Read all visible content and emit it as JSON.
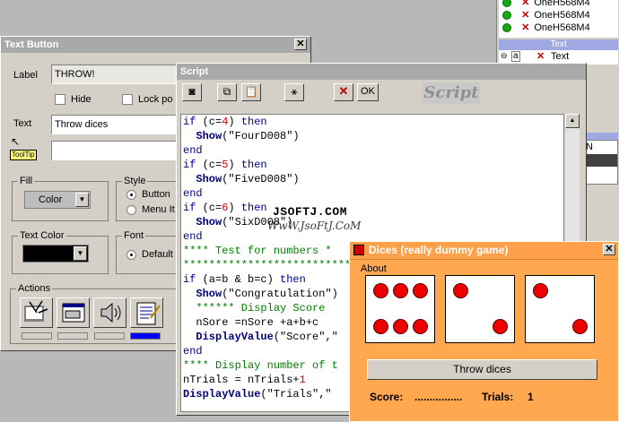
{
  "tree": {
    "items": [
      "OneH568M4",
      "OneH568M4",
      "OneH568M4"
    ],
    "section_title": "Text",
    "section_item": "Text",
    "side_letter": "N"
  },
  "text_button": {
    "title": "Text Button",
    "close": "✕",
    "label_caption": "Label",
    "label_value": "THROW!",
    "hide": "Hide",
    "lock": "Lock po",
    "text_caption": "Text",
    "text_value": "Throw dices",
    "tooltip_tag": "ToolTip",
    "fill_group": "Fill",
    "fill_value": "Color",
    "style_group": "Style",
    "style_button": "Button",
    "style_menu": "Menu It",
    "text_color_group": "Text Color",
    "font_group": "Font",
    "font_default": "Default",
    "actions_group": "Actions"
  },
  "script": {
    "title": "Script",
    "ok": "OK",
    "logo": "Script",
    "lines": [
      [
        {
          "t": "if",
          "c": "kw"
        },
        {
          "t": " (c=",
          "c": ""
        },
        {
          "t": "4",
          "c": "num"
        },
        {
          "t": ") ",
          "c": ""
        },
        {
          "t": "then",
          "c": "kw"
        }
      ],
      [
        {
          "t": "  ",
          "c": ""
        },
        {
          "t": "Show",
          "c": "fn"
        },
        {
          "t": "(\"FourD008\")",
          "c": ""
        }
      ],
      [
        {
          "t": "end",
          "c": "kw"
        }
      ],
      [
        {
          "t": "if",
          "c": "kw"
        },
        {
          "t": " (c=",
          "c": ""
        },
        {
          "t": "5",
          "c": "num"
        },
        {
          "t": ") ",
          "c": ""
        },
        {
          "t": "then",
          "c": "kw"
        }
      ],
      [
        {
          "t": "  ",
          "c": ""
        },
        {
          "t": "Show",
          "c": "fn"
        },
        {
          "t": "(\"FiveD008\")",
          "c": ""
        }
      ],
      [
        {
          "t": "end",
          "c": "kw"
        }
      ],
      [
        {
          "t": "if",
          "c": "kw"
        },
        {
          "t": " (c=",
          "c": ""
        },
        {
          "t": "6",
          "c": "num"
        },
        {
          "t": ") ",
          "c": ""
        },
        {
          "t": "then",
          "c": "kw"
        }
      ],
      [
        {
          "t": "  ",
          "c": ""
        },
        {
          "t": "Show",
          "c": "fn"
        },
        {
          "t": "(\"SixD008\")",
          "c": ""
        }
      ],
      [
        {
          "t": "end",
          "c": "kw"
        }
      ],
      [
        {
          "t": "**** Test for numbers *",
          "c": "cm"
        }
      ],
      [
        {
          "t": "*******************************",
          "c": "cm"
        }
      ],
      [
        {
          "t": "if",
          "c": "kw"
        },
        {
          "t": " (a=b & b=c) ",
          "c": ""
        },
        {
          "t": "then",
          "c": "kw"
        }
      ],
      [
        {
          "t": "  ",
          "c": ""
        },
        {
          "t": "Show",
          "c": "fn"
        },
        {
          "t": "(\"Congratulation\")",
          "c": ""
        }
      ],
      [
        {
          "t": "  ****** Display Score",
          "c": "cm"
        }
      ],
      [
        {
          "t": "  nSore =nSore +a+b+c",
          "c": ""
        }
      ],
      [
        {
          "t": "  ",
          "c": ""
        },
        {
          "t": "DisplayValue",
          "c": "fn"
        },
        {
          "t": "(\"Score\",\"",
          "c": ""
        }
      ],
      [
        {
          "t": "end",
          "c": "kw"
        }
      ],
      [
        {
          "t": "**** Display number of t",
          "c": "cm"
        }
      ],
      [
        {
          "t": "nTrials = nTrials+",
          "c": ""
        },
        {
          "t": "1",
          "c": "num"
        }
      ],
      [
        {
          "t": "DisplayValue",
          "c": "fn"
        },
        {
          "t": "(\"Trials\",\"",
          "c": ""
        }
      ]
    ]
  },
  "watermark": {
    "line1": "JSOFTJ.COM",
    "line2": "WwW.JsoFtJ.CoM"
  },
  "dices": {
    "title": "Dices (really dummy game)",
    "about": "About",
    "throw_button": "Throw dices",
    "score_label": "Score:",
    "score_value": "................",
    "trials_label": "Trials:",
    "trials_value": "1",
    "dice_values": [
      6,
      2,
      2
    ]
  }
}
